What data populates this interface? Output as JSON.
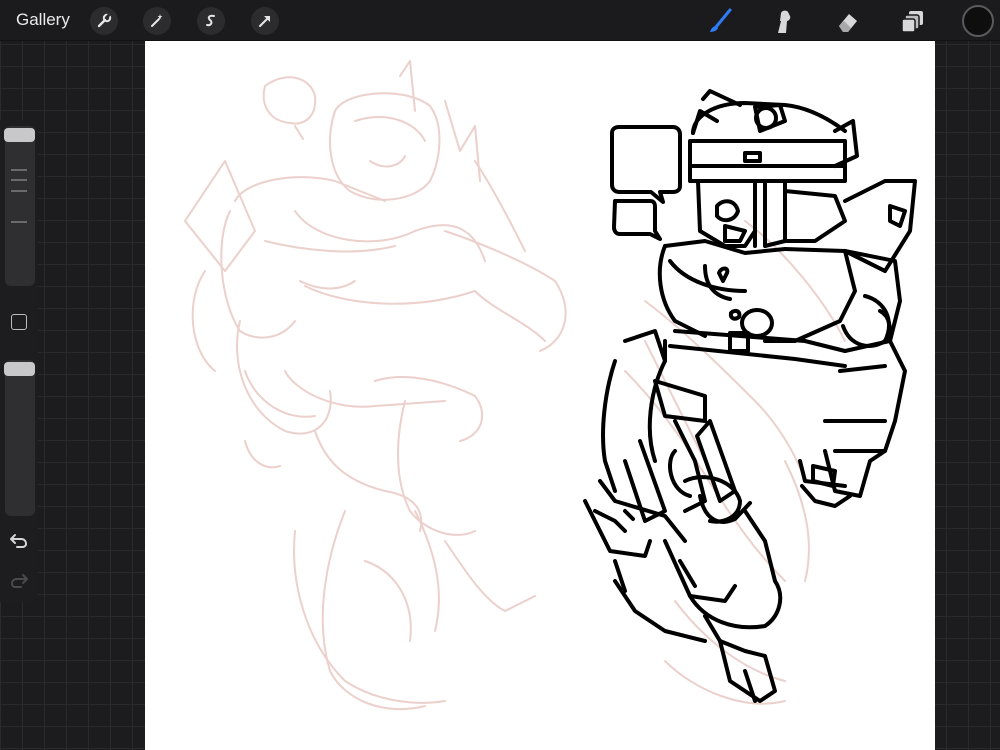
{
  "topbar": {
    "gallery_label": "Gallery",
    "action_tools": [
      "actions-wrench",
      "adjustments-wand",
      "selection-s",
      "transform-arrow"
    ],
    "drawing_tools": [
      "brush",
      "smudge",
      "eraser",
      "layers"
    ],
    "active_tool": "brush",
    "active_tool_color": "#2f7bf5",
    "current_color": "#0e0e0e"
  },
  "sidebar": {
    "controls": [
      "brush-size-slider",
      "modify-button",
      "brush-opacity-slider",
      "undo",
      "redo"
    ]
  },
  "canvas": {
    "background": "#ffffff",
    "sketch_color": "#ebd0cb",
    "ink_color": "#000000"
  }
}
